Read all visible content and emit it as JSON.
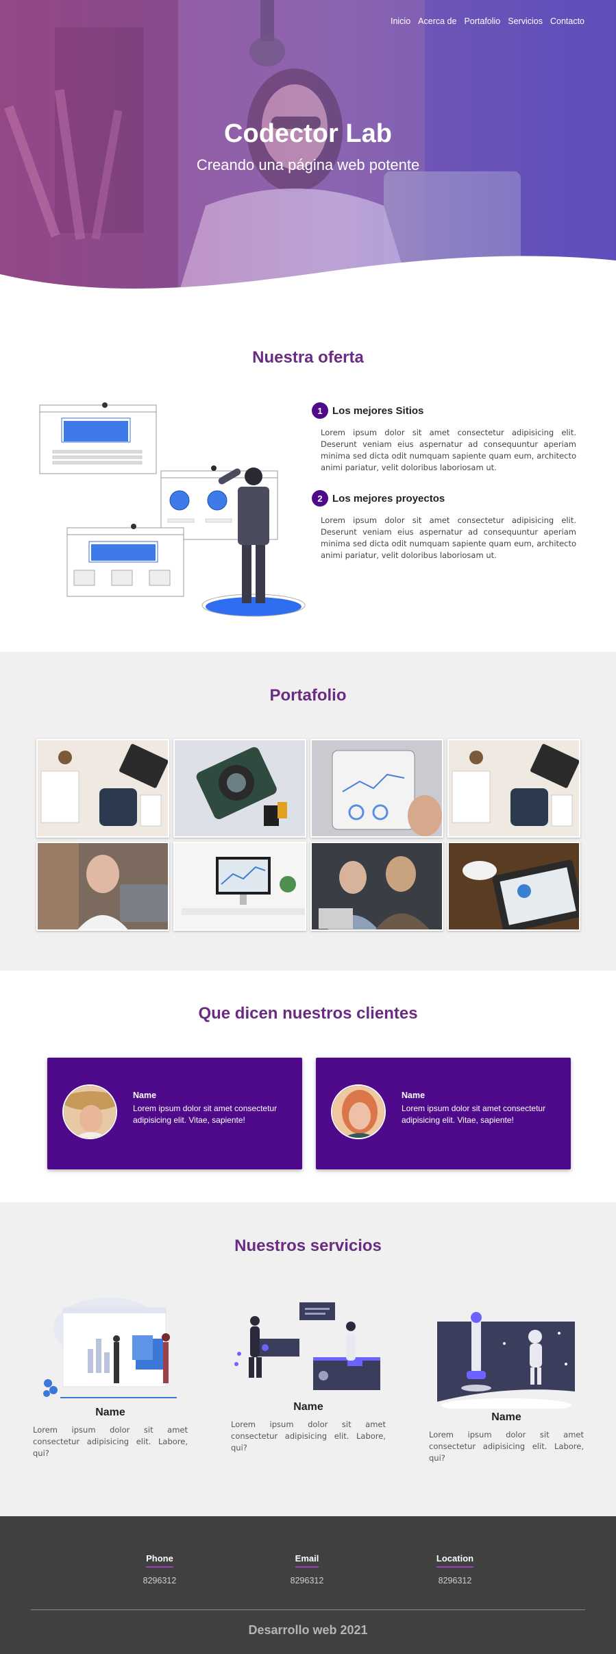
{
  "nav": {
    "items": [
      {
        "label": "Inicio"
      },
      {
        "label": "Acerca de"
      },
      {
        "label": "Portafolio"
      },
      {
        "label": "Servicios"
      },
      {
        "label": "Contacto"
      }
    ]
  },
  "hero": {
    "title": "Codector Lab",
    "subtitle": "Creando una página web potente"
  },
  "offer": {
    "title": "Nuestra oferta",
    "items": [
      {
        "number": "1",
        "title": "Los mejores Sitios",
        "text": "Lorem ipsum dolor sit amet consectetur adipisicing elit. Deserunt veniam eius aspernatur ad consequuntur aperiam minima sed dicta odit numquam sapiente quam eum, architecto animi pariatur, velit doloribus laboriosam ut."
      },
      {
        "number": "2",
        "title": "Los mejores proyectos",
        "text": "Lorem ipsum dolor sit amet consectetur adipisicing elit. Deserunt veniam eius aspernatur ad consequuntur aperiam minima sed dicta odit numquam sapiente quam eum, architecto animi pariatur, velit doloribus laboriosam ut."
      }
    ]
  },
  "portfolio": {
    "title": "Portafolio",
    "images": [
      {
        "icon": "desk-workspace-photo"
      },
      {
        "icon": "camera-photo"
      },
      {
        "icon": "tablet-chart-photo"
      },
      {
        "icon": "desk-workspace-photo"
      },
      {
        "icon": "woman-laptop-photo"
      },
      {
        "icon": "desktop-computer-photo"
      },
      {
        "icon": "team-meeting-photo"
      },
      {
        "icon": "tablet-dashboard-photo"
      }
    ]
  },
  "testimonials": {
    "title": "Que dicen nuestros clientes",
    "cards": [
      {
        "name": "Name",
        "text": "Lorem ipsum dolor sit amet consectetur adipisicing elit. Vitae, sapiente!"
      },
      {
        "name": "Name",
        "text": "Lorem ipsum dolor sit amet consectetur adipisicing elit. Vitae, sapiente!"
      }
    ]
  },
  "services": {
    "title": "Nuestros servicios",
    "items": [
      {
        "name": "Name",
        "text": "Lorem ipsum dolor sit amet consectetur adipisicing elit. Labore, qui?"
      },
      {
        "name": "Name",
        "text": "Lorem ipsum dolor sit amet consectetur adipisicing elit. Labore, qui?"
      },
      {
        "name": "Name",
        "text": "Lorem ipsum dolor sit amet consectetur adipisicing elit. Labore, qui?"
      }
    ]
  },
  "footer": {
    "columns": [
      {
        "label": "Phone",
        "value": "8296312"
      },
      {
        "label": "Email",
        "value": "8296312"
      },
      {
        "label": "Location",
        "value": "8296312"
      }
    ],
    "copyright": "Desarrollo web 2021"
  },
  "colors": {
    "accent": "#6a2c82",
    "card": "#4e0a8a",
    "footer": "#404040",
    "section_bg": "#f0f0f0"
  }
}
